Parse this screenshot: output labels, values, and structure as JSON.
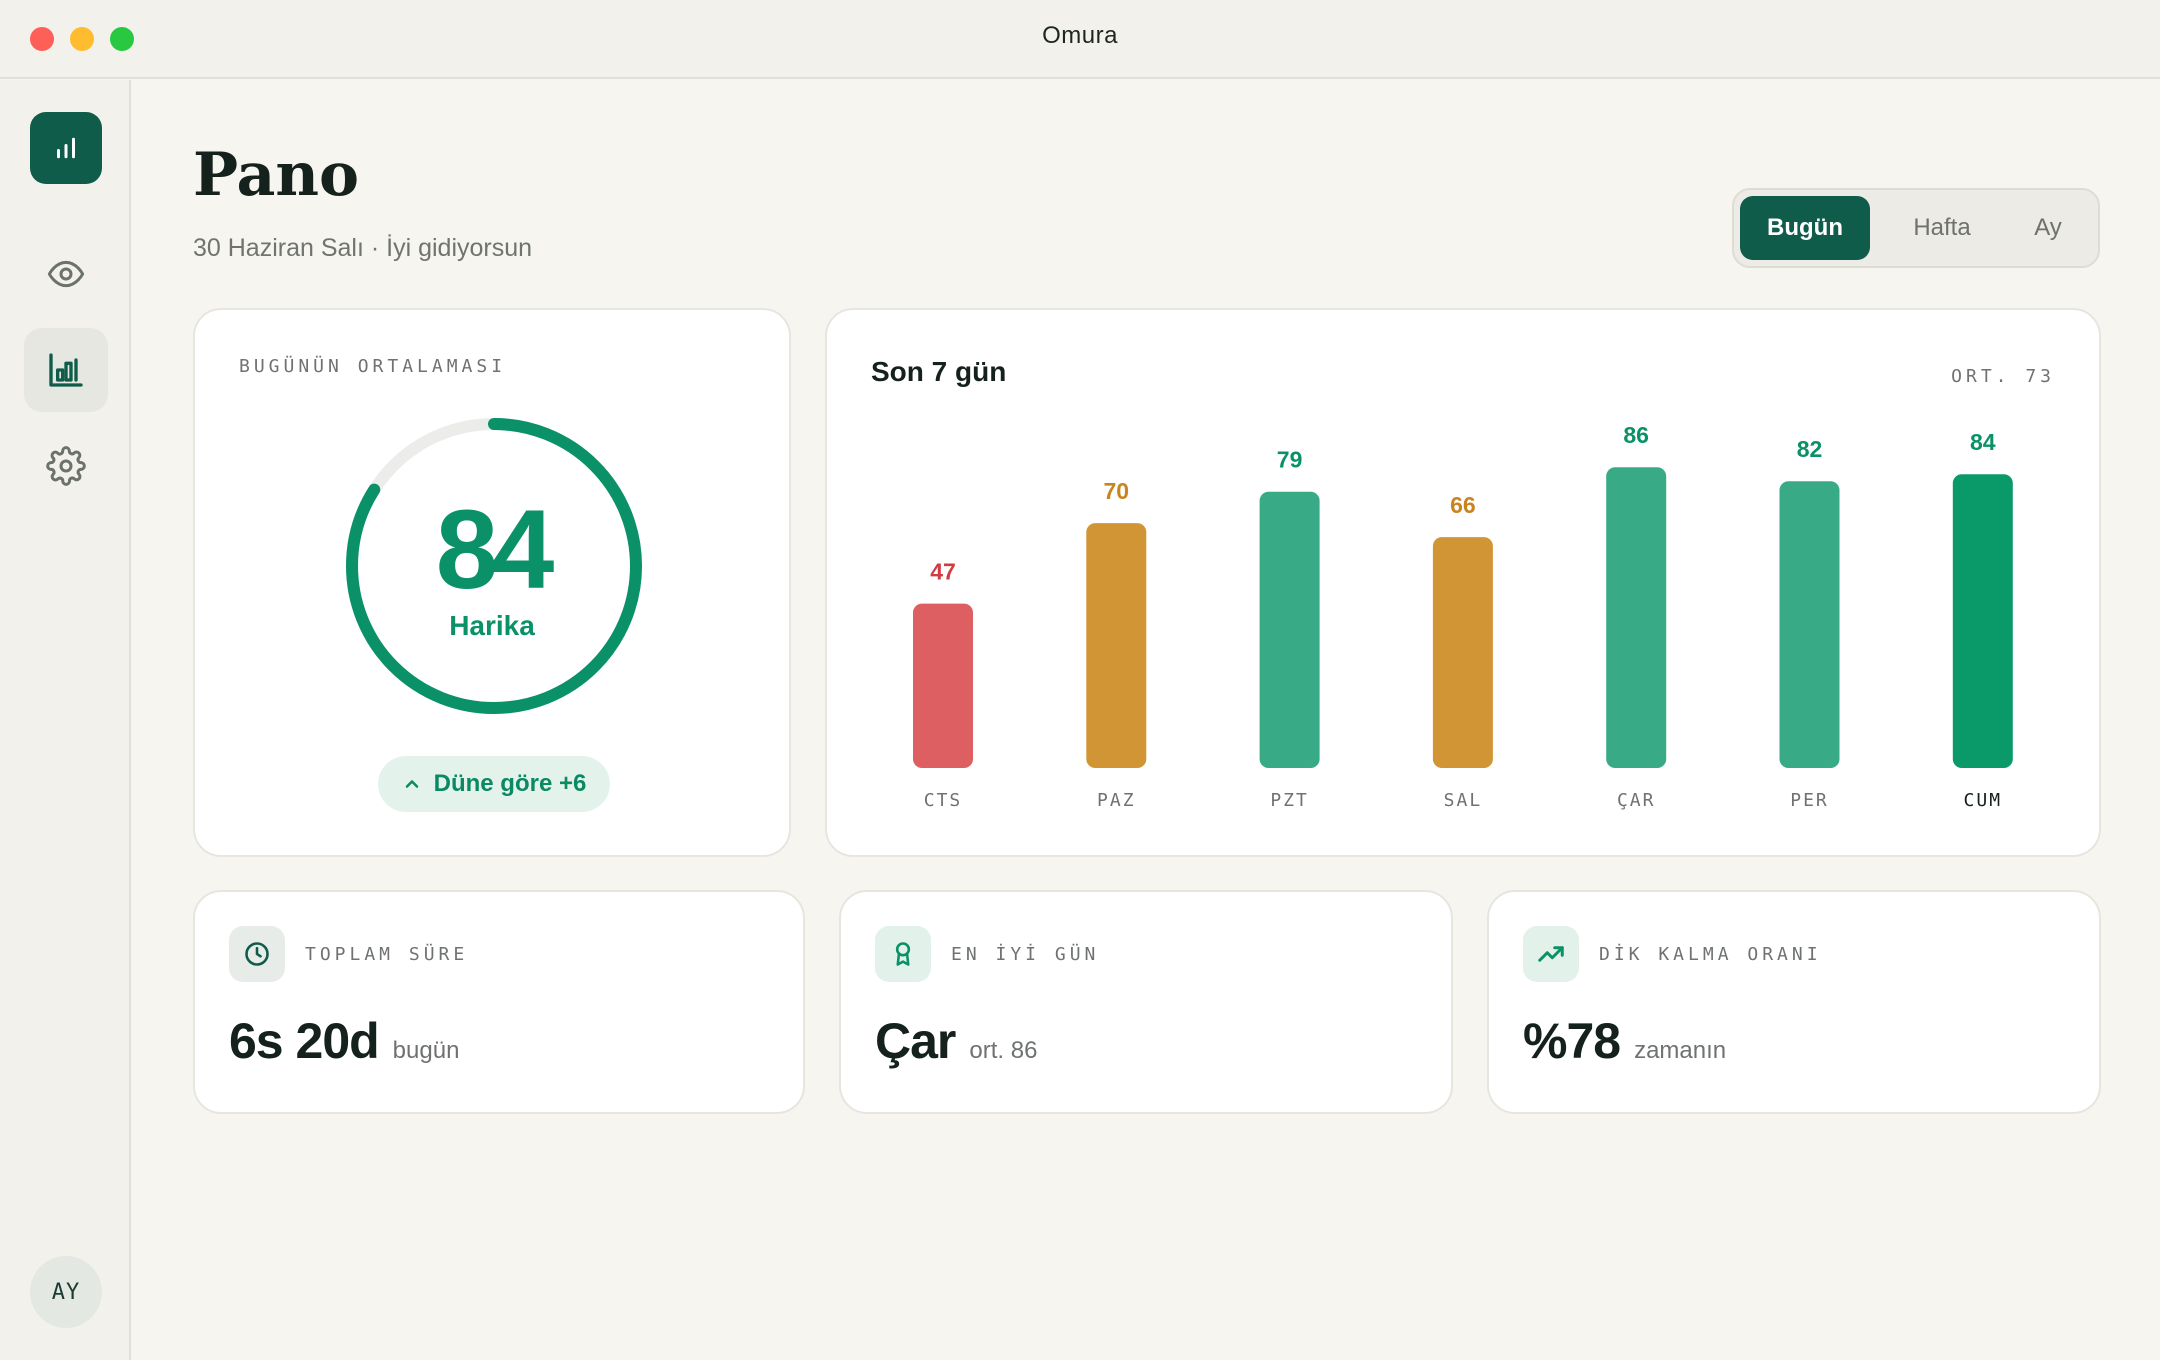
{
  "window": {
    "title": "Omura"
  },
  "sidebar": {
    "items": [
      {
        "name": "dashboard-logo",
        "icon": "bar-chart-icon",
        "active": false
      },
      {
        "name": "eye",
        "icon": "eye-icon",
        "active": false
      },
      {
        "name": "analytics",
        "icon": "chart-icon",
        "active": true
      },
      {
        "name": "settings",
        "icon": "gear-icon",
        "active": false
      }
    ],
    "avatar_initials": "AY"
  },
  "header": {
    "title": "Pano",
    "subtitle": "30 Haziran Salı · İyi gidiyorsun",
    "tabs": [
      {
        "label": "Bugün",
        "active": true
      },
      {
        "label": "Hafta",
        "active": false
      },
      {
        "label": "Ay",
        "active": false
      }
    ]
  },
  "score_card": {
    "label": "BUGÜNÜN ORTALAMASI",
    "value": "84",
    "status": "Harika",
    "progress": 0.84,
    "delta_label": "Düne göre +6",
    "delta_icon": "chevron-up-icon"
  },
  "week_card": {
    "title": "Son 7 gün",
    "avg_label": "ORT. 73"
  },
  "chart_data": {
    "type": "bar",
    "categories": [
      "CTS",
      "PAZ",
      "PZT",
      "SAL",
      "ÇAR",
      "PER",
      "CUM"
    ],
    "values": [
      47,
      70,
      79,
      66,
      86,
      82,
      84
    ],
    "colors": [
      "#dd5f61",
      "#d29535",
      "#38ab86",
      "#d29535",
      "#38ab86",
      "#38ab86",
      "#0a9a6a"
    ],
    "label_colors": [
      "#d13c42",
      "#c98420",
      "#0a9168",
      "#c98420",
      "#0a9168",
      "#0a9168",
      "#0a9168"
    ],
    "highlight_index": 6,
    "grid": false,
    "average": 73
  },
  "stats": [
    {
      "icon": "clock-icon",
      "label": "TOPLAM SÜRE",
      "value": "6s 20d",
      "suffix": "bugün"
    },
    {
      "icon": "award-icon",
      "label": "EN İYİ GÜN",
      "value": "Çar",
      "suffix": "ort. 86"
    },
    {
      "icon": "trending-up-icon",
      "label": "DİK KALMA ORANI",
      "value": "%78",
      "suffix": "zamanın"
    }
  ],
  "colors": {
    "primary": "#0f5c4b",
    "success": "#0a9168",
    "warning": "#d29535",
    "danger": "#dd5f61",
    "background": "#f7f5f0"
  }
}
